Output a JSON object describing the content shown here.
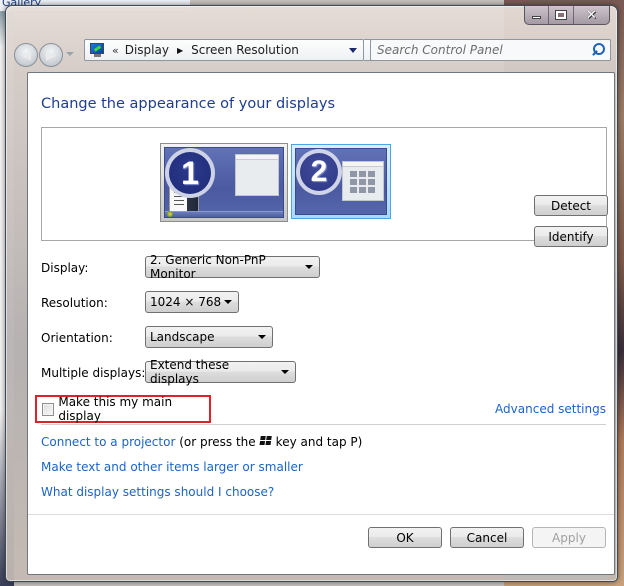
{
  "background": {
    "behind_window_text": "Gallery"
  },
  "window": {
    "caption_buttons": {
      "minimize": "minimize",
      "maximize": "maximize",
      "close": "close"
    }
  },
  "navbar": {
    "back_icon": "back-arrow-icon",
    "forward_icon": "forward-arrow-icon",
    "address": {
      "overflow": "«",
      "crumbs": [
        "Display",
        "Screen Resolution"
      ]
    },
    "refresh_icon": "refresh-icon",
    "search": {
      "placeholder": "Search Control Panel",
      "value": ""
    }
  },
  "main": {
    "heading": "Change the appearance of your displays",
    "monitors": [
      {
        "number": "1",
        "selected": false
      },
      {
        "number": "2",
        "selected": true
      }
    ],
    "detect_label": "Detect",
    "identify_label": "Identify",
    "fields": {
      "display": {
        "label": "Display:",
        "value": "2. Generic Non-PnP Monitor"
      },
      "resolution": {
        "label": "Resolution:",
        "value": "1024 × 768"
      },
      "orientation": {
        "label": "Orientation:",
        "value": "Landscape"
      },
      "multiple": {
        "label": "Multiple displays:",
        "value": "Extend these displays"
      }
    },
    "main_display": {
      "label": "Make this my main display",
      "checked": false
    },
    "advanced_link": "Advanced settings",
    "links": {
      "projector": "Connect to a projector",
      "projector_hint_pre": "(or press the",
      "projector_hint_post": "key and tap P)",
      "text_size": "Make text and other items larger or smaller",
      "help": "What display settings should I choose?"
    },
    "buttons": {
      "ok": "OK",
      "cancel": "Cancel",
      "apply": "Apply",
      "apply_enabled": false
    }
  },
  "colors": {
    "heading": "#1e3e8e",
    "link": "#1c63c8",
    "highlight_box": "#e0202a"
  }
}
